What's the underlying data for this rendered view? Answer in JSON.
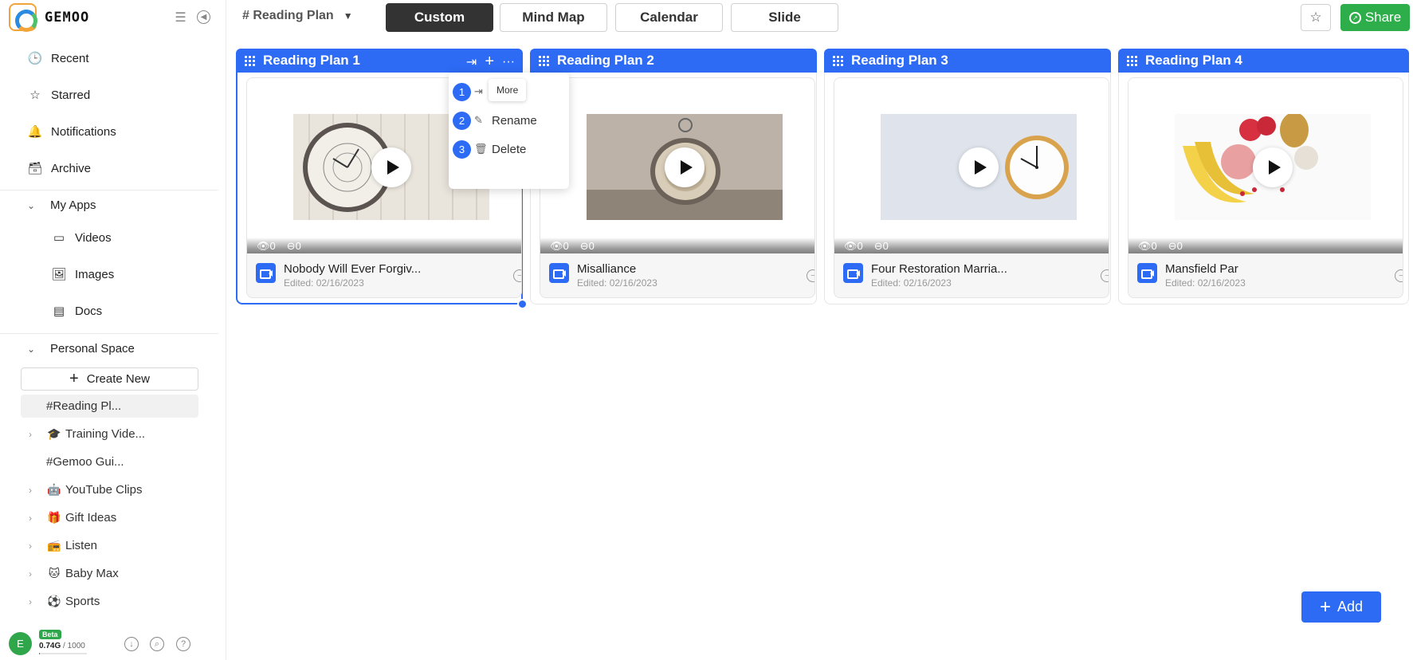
{
  "brand": {
    "name": "GEMOO"
  },
  "nav": {
    "recent": "Recent",
    "starred": "Starred",
    "notifications": "Notifications",
    "archive": "Archive"
  },
  "my_apps": {
    "label": "My Apps",
    "videos": "Videos",
    "images": "Images",
    "docs": "Docs"
  },
  "personal_space": {
    "label": "Personal Space",
    "create_new": "Create New",
    "items": [
      {
        "label": "#Reading Pl...",
        "emoji": "",
        "expandable": false,
        "active": true
      },
      {
        "label": "Training Vide...",
        "emoji": "🎓",
        "expandable": true,
        "active": false
      },
      {
        "label": "#Gemoo Gui...",
        "emoji": "",
        "expandable": false,
        "active": false
      },
      {
        "label": "YouTube Clips",
        "emoji": "🤖",
        "expandable": true,
        "active": false
      },
      {
        "label": "Gift Ideas",
        "emoji": "🎁",
        "expandable": true,
        "active": false
      },
      {
        "label": "Listen",
        "emoji": "📻",
        "expandable": true,
        "active": false
      },
      {
        "label": "Baby Max",
        "emoji": "🐱",
        "expandable": true,
        "active": false
      },
      {
        "label": "Sports",
        "emoji": "⚽",
        "expandable": true,
        "active": false
      }
    ]
  },
  "footer": {
    "avatar_initial": "E",
    "badge": "Beta",
    "usage_used": "0.74G",
    "usage_max": " / 1000",
    "usage_fraction": 0.00074
  },
  "header": {
    "doc_title": "# Reading Plan",
    "views": [
      "Custom",
      "Mind Map",
      "Calendar",
      "Slide"
    ],
    "active_view": "Custom",
    "share_label": "Share"
  },
  "columns": [
    {
      "title": "Reading Plan 1",
      "card": {
        "title": "Nobody Will Ever Forgiv...",
        "date": "Edited: 02/16/2023",
        "views": "0",
        "comments": "0"
      }
    },
    {
      "title": "Reading Plan 2",
      "card": {
        "title": "Misalliance",
        "date": "Edited: 02/16/2023",
        "views": "0",
        "comments": "0"
      }
    },
    {
      "title": "Reading Plan 3",
      "card": {
        "title": "Four Restoration Marria...",
        "date": "Edited: 02/16/2023",
        "views": "0",
        "comments": "0"
      }
    },
    {
      "title": "Reading Plan 4",
      "card": {
        "title": "Mansfield Par",
        "date": "Edited: 02/16/2023",
        "views": "0",
        "comments": "0"
      }
    }
  ],
  "context_menu": {
    "tooltip": "More",
    "items": [
      {
        "num": "1",
        "label": ""
      },
      {
        "num": "2",
        "label": "Rename"
      },
      {
        "num": "3",
        "label": "Delete"
      }
    ]
  },
  "add_button": "Add",
  "colors": {
    "accent": "#2d6bf5",
    "share": "#2eae4a",
    "dark": "#333333"
  }
}
